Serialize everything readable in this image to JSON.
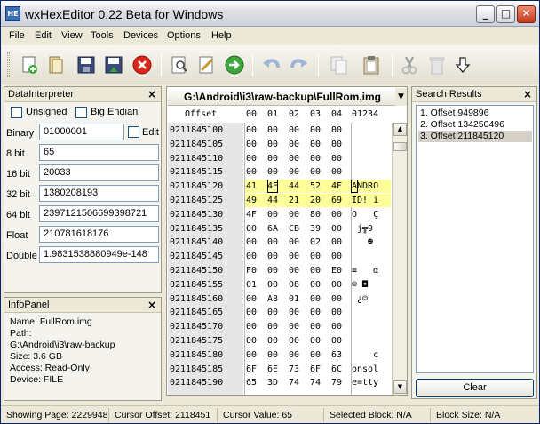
{
  "window": {
    "title": "wxHexEditor 0.22 Beta for Windows",
    "icon_text": "HE",
    "controls": [
      "minimize",
      "maximize",
      "close"
    ]
  },
  "menu": [
    "File",
    "Edit",
    "View",
    "Tools",
    "Devices",
    "Options",
    "Help"
  ],
  "toolbar": {
    "icons": [
      "new-file-icon",
      "open-file-icon",
      "save-icon",
      "save-as-icon",
      "close-file-icon",
      "find-icon",
      "replace-icon",
      "goto-icon",
      "undo-icon",
      "redo-icon",
      "copy-icon",
      "paste-icon",
      "cut-icon",
      "delete-icon",
      "insert-icon"
    ]
  },
  "data_interpreter": {
    "title": "DataInterpreter",
    "unsigned_label": "Unsigned",
    "big_endian_label": "Big Endian",
    "edit_label": "Edit",
    "rows": [
      {
        "label": "Binary",
        "value": "01000001"
      },
      {
        "label": "8 bit",
        "value": "65"
      },
      {
        "label": "16 bit",
        "value": "20033"
      },
      {
        "label": "32 bit",
        "value": "1380208193"
      },
      {
        "label": "64 bit",
        "value": "2397121506699398721"
      },
      {
        "label": "Float",
        "value": "210781618176"
      },
      {
        "label": "Double",
        "value": "1.9831538880949e-148"
      }
    ]
  },
  "info_panel": {
    "title": "InfoPanel",
    "lines": [
      "Name:  FullRom.img",
      "Path:",
      "G:\\Android\\i3\\raw-backup",
      "Size:     3.6 GB",
      "Access: Read-Only",
      "Device: FILE"
    ]
  },
  "hex_editor": {
    "path": "G:\\Android\\i3\\raw-backup\\FullRom.img",
    "offset_header": "Offset",
    "byte_headers": [
      "00",
      "01",
      "02",
      "03",
      "04"
    ],
    "text_header": "01234",
    "rows": [
      {
        "offset": "0211845100",
        "hex": [
          "00",
          "00",
          "00",
          "00",
          "00"
        ],
        "text": ""
      },
      {
        "offset": "0211845105",
        "hex": [
          "00",
          "00",
          "00",
          "00",
          "00"
        ],
        "text": ""
      },
      {
        "offset": "0211845110",
        "hex": [
          "00",
          "00",
          "00",
          "00",
          "00"
        ],
        "text": ""
      },
      {
        "offset": "0211845115",
        "hex": [
          "00",
          "00",
          "00",
          "00",
          "00"
        ],
        "text": ""
      },
      {
        "offset": "0211845120",
        "hex": [
          "41",
          "4E",
          "44",
          "52",
          "4F"
        ],
        "text": "ANDRO"
      },
      {
        "offset": "0211845125",
        "hex": [
          "49",
          "44",
          "21",
          "20",
          "69"
        ],
        "text": "ID! i"
      },
      {
        "offset": "0211845130",
        "hex": [
          "4F",
          "00",
          "00",
          "80",
          "00"
        ],
        "text": "O   Ç"
      },
      {
        "offset": "0211845135",
        "hex": [
          "00",
          "6A",
          "CB",
          "39",
          "00"
        ],
        "text": " j╦9"
      },
      {
        "offset": "0211845140",
        "hex": [
          "00",
          "00",
          "00",
          "02",
          "00"
        ],
        "text": "   ☻"
      },
      {
        "offset": "0211845145",
        "hex": [
          "00",
          "00",
          "00",
          "00",
          "00"
        ],
        "text": ""
      },
      {
        "offset": "0211845150",
        "hex": [
          "F0",
          "00",
          "00",
          "00",
          "E0"
        ],
        "text": "≡   α"
      },
      {
        "offset": "0211845155",
        "hex": [
          "01",
          "00",
          "08",
          "00",
          "00"
        ],
        "text": "☺ ◘"
      },
      {
        "offset": "0211845160",
        "hex": [
          "00",
          "A8",
          "01",
          "00",
          "00"
        ],
        "text": " ¿☺"
      },
      {
        "offset": "0211845165",
        "hex": [
          "00",
          "00",
          "00",
          "00",
          "00"
        ],
        "text": ""
      },
      {
        "offset": "0211845170",
        "hex": [
          "00",
          "00",
          "00",
          "00",
          "00"
        ],
        "text": ""
      },
      {
        "offset": "0211845175",
        "hex": [
          "00",
          "00",
          "00",
          "00",
          "00"
        ],
        "text": ""
      },
      {
        "offset": "0211845180",
        "hex": [
          "00",
          "00",
          "00",
          "00",
          "63"
        ],
        "text": "    c"
      },
      {
        "offset": "0211845185",
        "hex": [
          "6F",
          "6E",
          "73",
          "6F",
          "6C"
        ],
        "text": "onsol"
      },
      {
        "offset": "0211845190",
        "hex": [
          "65",
          "3D",
          "74",
          "74",
          "79"
        ],
        "text": "e=tty"
      }
    ]
  },
  "search_results": {
    "title": "Search Results",
    "items": [
      "1. Offset 949896",
      "2. Offset 134250496",
      "3. Offset 211845120"
    ],
    "selected_index": 2,
    "clear_label": "Clear"
  },
  "status_bar": [
    "Showing Page: 2229948",
    "Cursor Offset: 2118451",
    "Cursor Value: 65",
    "Selected Block: N/A",
    "Block Size: N/A"
  ],
  "colors": {
    "highlight": "#ffff99",
    "offset_bg": "#e6e6e6",
    "panel_bg": "#f4f3ee",
    "chrome": "#ece9d8"
  }
}
